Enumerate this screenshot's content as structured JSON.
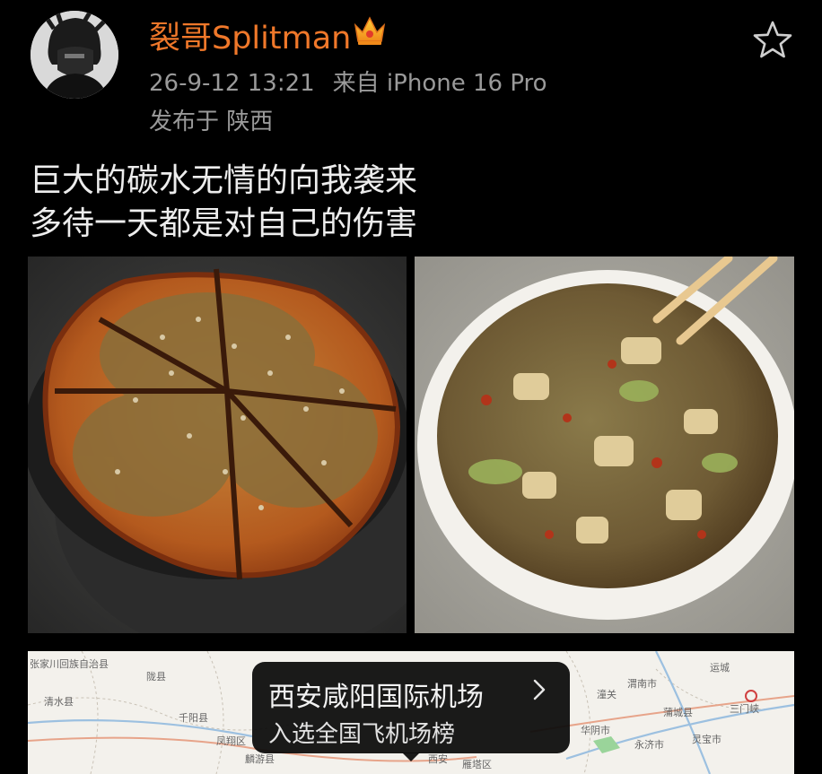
{
  "post": {
    "username": "裂哥Splitman",
    "timestamp": "26-9-12 13:21",
    "source": "来自 iPhone 16 Pro",
    "location": "发布于 陕西",
    "text_lines": [
      "巨大的碳水无情的向我袭来",
      "多待一天都是对自己的伤害"
    ]
  },
  "icons": {
    "avatar": "avatar",
    "badge": "crown-icon",
    "favorite": "star-icon",
    "poi_arrow": "chevron-right-icon"
  },
  "colors": {
    "background": "#000000",
    "username": "#f0782a",
    "meta": "#9a9a9a",
    "text": "#ededed"
  },
  "map": {
    "labels": [
      "张家川回族自治县",
      "清水县",
      "陇县",
      "千阳县",
      "凤翔区",
      "麟游县",
      "华阴市",
      "潼关",
      "蒲城县",
      "渭南市",
      "三门峡",
      "灵宝市",
      "运城",
      "永济市",
      "西安",
      "雁塔区"
    ],
    "poi_card": {
      "title": "西安咸阳国际机场",
      "subtitle": "入选全国飞机场榜"
    }
  }
}
